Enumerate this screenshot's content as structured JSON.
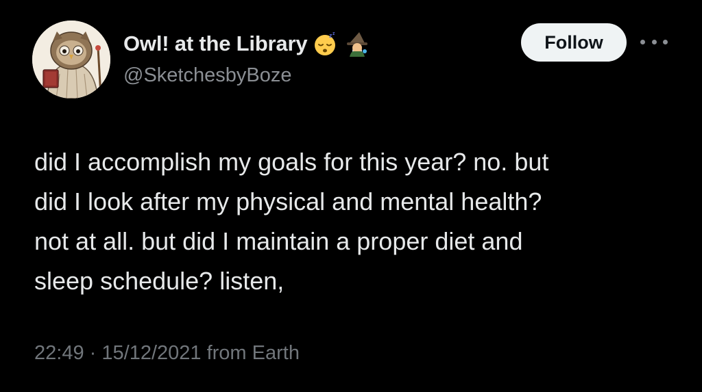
{
  "profile": {
    "display_name": "Owl! at the Library",
    "handle": "@SketchesbyBoze",
    "emojis": [
      "sleeping-face-icon",
      "mage-icon"
    ]
  },
  "actions": {
    "follow_label": "Follow",
    "more_icon": "more-horizontal-icon"
  },
  "tweet": {
    "lines": [
      "did I accomplish my goals for this year? no. but",
      "did I look after my physical and mental health?",
      "not at all. but did I maintain a proper diet and",
      "sleep schedule? listen,"
    ],
    "time": "22:49",
    "separator": "·",
    "date": "15/12/2021",
    "source": "from Earth"
  },
  "colors": {
    "background": "#000000",
    "text_primary": "#e7e9ea",
    "text_secondary": "#71767b",
    "follow_bg": "#eff3f4",
    "follow_text": "#0f1419"
  }
}
